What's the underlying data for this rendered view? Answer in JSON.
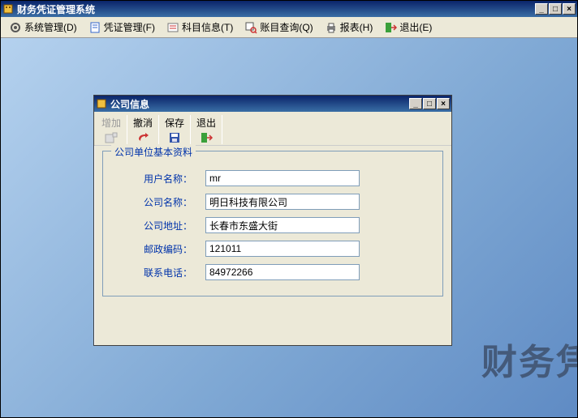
{
  "main": {
    "title": "财务凭证管理系统"
  },
  "menu": {
    "system": "系统管理(D)",
    "voucher": "凭证管理(F)",
    "subject": "科目信息(T)",
    "account": "账目查询(Q)",
    "report": "报表(H)",
    "exit": "退出(E)"
  },
  "watermark": "财务凭",
  "child": {
    "title": "公司信息",
    "toolbar": {
      "add": "增加",
      "cancel": "撤消",
      "save": "保存",
      "exit": "退出"
    },
    "group_title": "公司单位基本资料",
    "fields": {
      "username_label": "用户名称：",
      "username_value": "mr",
      "company_label": "公司名称：",
      "company_value": "明日科技有限公司",
      "address_label": "公司地址：",
      "address_value": "长春市东盛大街",
      "postcode_label": "邮政编码：",
      "postcode_value": "121011",
      "phone_label": "联系电话：",
      "phone_value": "84972266"
    }
  }
}
